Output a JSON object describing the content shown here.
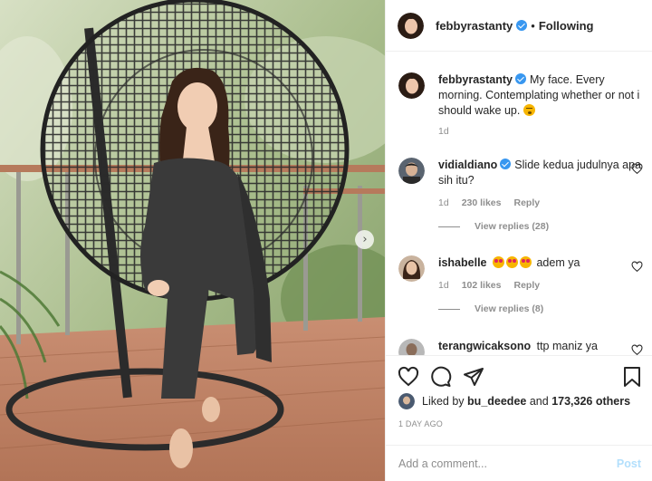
{
  "post": {
    "author": "febbyrastanty",
    "follow_status": "Following",
    "separator": "•"
  },
  "caption": {
    "username": "febbyrastanty",
    "text": "My face. Every morning. Contemplating whether or not i should wake up.",
    "emoji": "sleepy-face-emoji",
    "time": "1d"
  },
  "comments": [
    {
      "username": "vidialdiano",
      "verified": true,
      "text": "Slide kedua judulnya apa sih itu?",
      "time": "1d",
      "likes": "230 likes",
      "reply": "Reply",
      "view_replies": "View replies (28)"
    },
    {
      "username": "ishabelle",
      "verified": false,
      "text": "adem ya",
      "emojis": [
        "heart-eyes-emoji",
        "heart-eyes-emoji",
        "heart-eyes-emoji"
      ],
      "time": "1d",
      "likes": "102 likes",
      "reply": "Reply",
      "view_replies": "View replies (8)"
    },
    {
      "username": "terangwicaksono",
      "verified": false,
      "text": "ttp maniz ya"
    }
  ],
  "likes": {
    "prefix": "Liked by",
    "user": "bu_deedee",
    "conjunction": "and",
    "others": "173,326 others"
  },
  "time_ago": "1 DAY AGO",
  "add_comment": {
    "placeholder": "Add a comment...",
    "post_label": "Post"
  },
  "icons": {
    "like": "heart-icon",
    "comment": "comment-bubble-icon",
    "share": "paper-plane-icon",
    "save": "bookmark-icon",
    "next": "chevron-right-icon"
  },
  "colors": {
    "verified": "#3897f0",
    "post_disabled": "#b2dffc",
    "meta": "#8e8e8e",
    "text": "#262626"
  }
}
